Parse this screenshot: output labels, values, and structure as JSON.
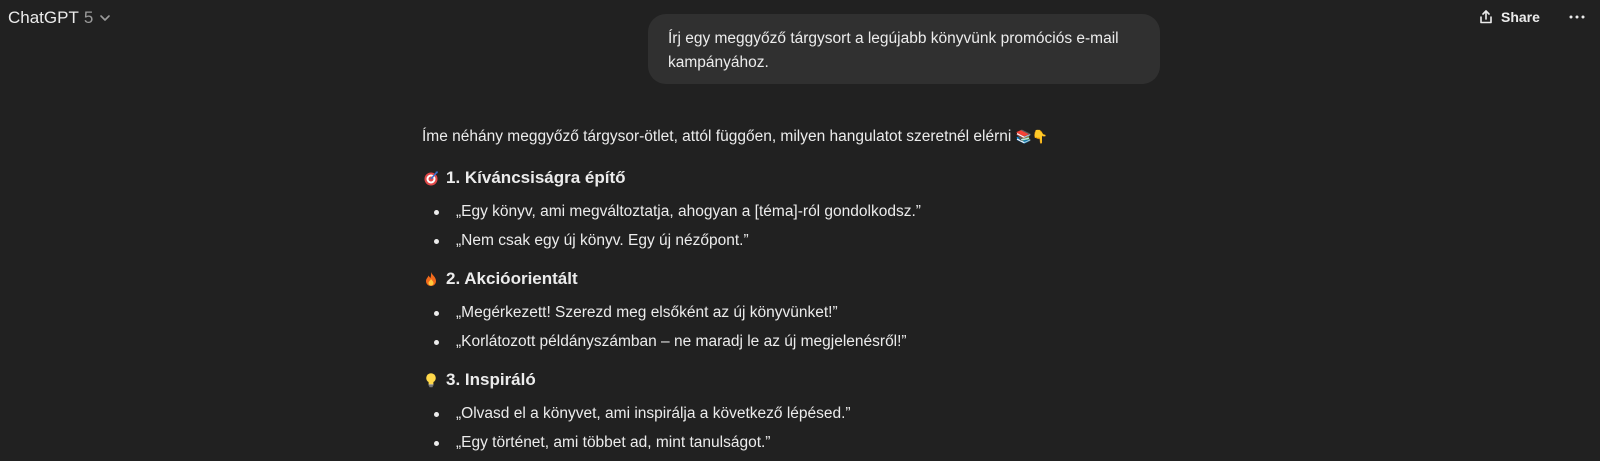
{
  "header": {
    "model_name": "ChatGPT",
    "model_version": "5",
    "share_label": "Share"
  },
  "user_message": {
    "line1": "Írj egy meggyőző tárgysort a legújabb könyvünk promóciós e-mail",
    "line2": "kampányához."
  },
  "assistant": {
    "intro": "Íme néhány meggyőző tárgysor-ötlet, attól függően, milyen hangulatot szeretnél elérni",
    "intro_emoji": "📚👇",
    "sections": [
      {
        "icon": "target-icon",
        "heading": "1. Kíváncsiságra építő",
        "items": [
          "„Egy könyv, ami megváltoztatja, ahogyan a [téma]-ról gondolkodsz.”",
          "„Nem csak egy új könyv. Egy új nézőpont.”"
        ]
      },
      {
        "icon": "fire-icon",
        "heading": "2. Akcióorientált",
        "items": [
          "„Megérkezett! Szerezd meg elsőként az új könyvünket!”",
          "„Korlátozott példányszámban – ne maradj le az új megjelenésről!”"
        ]
      },
      {
        "icon": "lightbulb-icon",
        "heading": "3. Inspiráló",
        "items": [
          "„Olvasd el a könyvet, ami inspirálja a következő lépésed.”",
          "„Egy történet, ami többet ad, mint tanulságot.”"
        ]
      }
    ]
  },
  "colors": {
    "background": "#212121",
    "bubble": "#303030",
    "text": "#ececec",
    "muted": "#9b9b9b"
  }
}
